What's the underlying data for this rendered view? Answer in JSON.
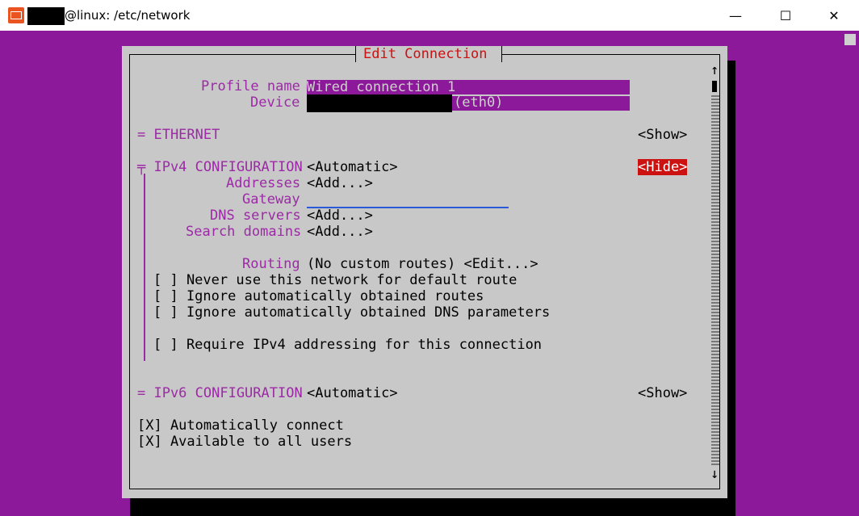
{
  "window": {
    "title_suffix": "@linux: /etc/network",
    "minimize": "—",
    "maximize": "☐",
    "close": "✕"
  },
  "dialog": {
    "title": "Edit Connection",
    "profile_label": "Profile name",
    "profile_value": "Wired connection 1",
    "device_label": "Device",
    "device_suffix": "(eth0)",
    "ethernet_label": "= ETHERNET",
    "ethernet_show": "<Show>",
    "ipv4_label": "╤ IPv4 CONFIGURATION",
    "ipv4_mode": "<Automatic>",
    "ipv4_hide": "<Hide>",
    "addresses_label": "Addresses",
    "addresses_value": "<Add...>",
    "gateway_label": "Gateway",
    "dns_label": "DNS servers",
    "dns_value": "<Add...>",
    "search_label": "Search domains",
    "search_value": "<Add...>",
    "routing_label": "Routing",
    "routing_value": "(No custom routes) <Edit...>",
    "never_default": "[ ] Never use this network for default route",
    "ignore_routes": "[ ] Ignore automatically obtained routes",
    "ignore_dns": "[ ] Ignore automatically obtained DNS parameters",
    "require_ipv4": "[ ] Require IPv4 addressing for this connection",
    "ipv6_label": "= IPv6 CONFIGURATION",
    "ipv6_mode": "<Automatic>",
    "ipv6_show": "<Show>",
    "auto_connect": "[X] Automatically connect",
    "all_users": "[X] Available to all users",
    "scroll_up": "↑",
    "scroll_down": "↓"
  }
}
